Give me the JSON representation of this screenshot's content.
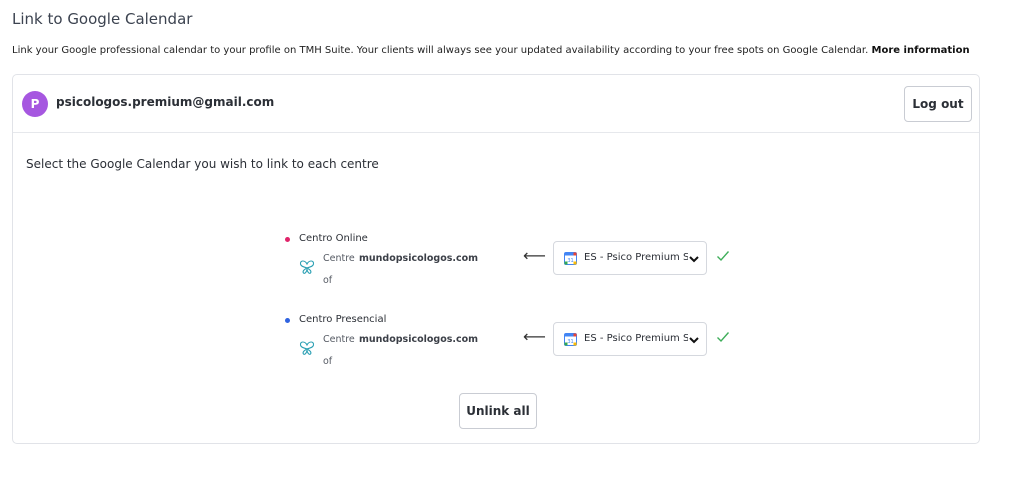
{
  "page": {
    "title": "Link to Google Calendar",
    "intro_text": "Link your Google professional calendar to your profile on TMH Suite. Your clients will always see your updated availability according to your free spots on Google Calendar.",
    "more_info_label": "More information"
  },
  "account": {
    "avatar_initial": "P",
    "email": "psicologos.premium@gmail.com",
    "logout_label": "Log out"
  },
  "main": {
    "instruction": "Select the Google Calendar you wish to link to each centre",
    "centres": [
      {
        "name": "Centro Online",
        "dot_color": "#e0246a",
        "prefix": "Centre",
        "site": "mundopsicologos.com",
        "suffix": "of",
        "calendar": "ES - Psico Premium Su"
      },
      {
        "name": "Centro Presencial",
        "dot_color": "#2f63e0",
        "prefix": "Centre",
        "site": "mundopsicologos.com",
        "suffix": "of",
        "calendar": "ES - Psico Premium Su"
      }
    ],
    "unlink_all_label": "Unlink all"
  },
  "colors": {
    "avatar": "#a657e0",
    "check": "#3fae5a",
    "brand_icon": "#2a9fb3"
  }
}
